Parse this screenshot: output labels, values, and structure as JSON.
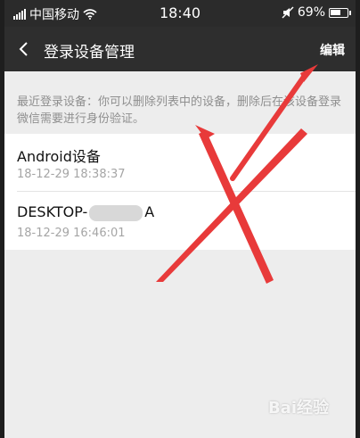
{
  "statusbar": {
    "carrier": "中国移动",
    "time": "18:40",
    "battery": "69%",
    "battery_level": 0.69
  },
  "navbar": {
    "title": "登录设备管理",
    "edit_label": "编辑"
  },
  "hint": "最近登录设备：你可以删除列表中的设备，删除后在该设备登录微信需要进行身份验证。",
  "devices": [
    {
      "name": "Android设备",
      "time": "18-12-29 18:38:37"
    },
    {
      "name_prefix": "DESKTOP-",
      "name_suffix": "A",
      "time": "18-12-29 16:46:01"
    }
  ],
  "watermark": "Bai经验",
  "colors": {
    "annotation": "#e83a3a",
    "navbar": "#2e2e2e",
    "background": "#ededed"
  }
}
